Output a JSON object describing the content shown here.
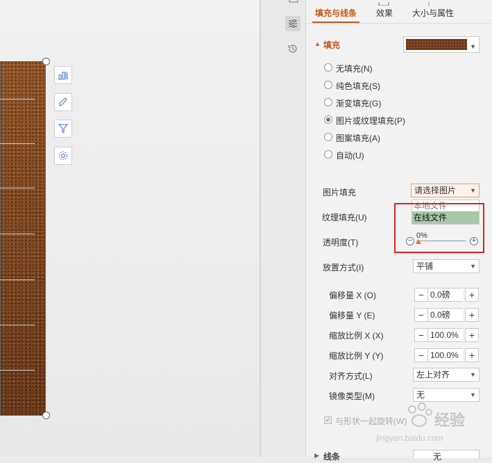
{
  "tabs": [
    {
      "label": "填充与线条",
      "active": true
    },
    {
      "label": "效果",
      "active": false
    },
    {
      "label": "大小与属性",
      "active": false
    }
  ],
  "fill_section": {
    "title": "填充",
    "radios": [
      {
        "label": "无填充(N)",
        "checked": false
      },
      {
        "label": "纯色填充(S)",
        "checked": false
      },
      {
        "label": "渐变填充(G)",
        "checked": false
      },
      {
        "label": "图片或纹理填充(P)",
        "checked": true
      },
      {
        "label": "图案填充(A)",
        "checked": false
      },
      {
        "label": "自动(U)",
        "checked": false
      }
    ]
  },
  "picture_fill": {
    "label": "图片填充",
    "value": "请选择图片",
    "options": [
      "本地文件",
      "在线文件"
    ],
    "highlighted_option": "在线文件"
  },
  "texture_fill": {
    "label": "纹理填充(U)"
  },
  "transparency": {
    "label": "透明度(T)",
    "value": "0%"
  },
  "placement": {
    "label": "放置方式(I)",
    "value": "平铺"
  },
  "offset_x": {
    "label": "偏移量 X (O)",
    "value": "0.0磅"
  },
  "offset_y": {
    "label": "偏移量 Y (E)",
    "value": "0.0磅"
  },
  "scale_x": {
    "label": "缩放比例 X (X)",
    "value": "100.0%"
  },
  "scale_y": {
    "label": "缩放比例 Y (Y)",
    "value": "100.0%"
  },
  "alignment": {
    "label": "对齐方式(L)",
    "value": "左上对齐"
  },
  "mirror": {
    "label": "镜像类型(M)",
    "value": "无"
  },
  "rotate_with_shape": {
    "label": "与形状一起旋转(W)",
    "checked": true
  },
  "line_section": {
    "title": "线条",
    "value": "无"
  },
  "stepper": {
    "minus": "−",
    "plus": "+"
  },
  "watermark": {
    "text": "经验",
    "url": "jingyan.baidu.com"
  },
  "colors": {
    "accent": "#c4561a",
    "highlight_box": "#e02020",
    "selected_option": "#a9c8a9"
  }
}
